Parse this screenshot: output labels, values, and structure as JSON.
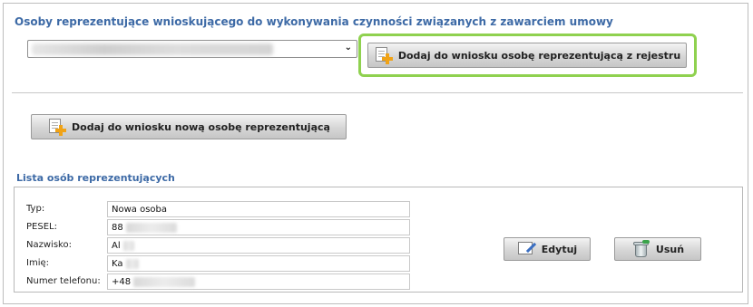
{
  "section": {
    "title": "Osoby reprezentujące wnioskującego do wykonywania czynności związanych z zawarciem umowy"
  },
  "select": {
    "selected_value": "—"
  },
  "buttons": {
    "add_from_registry": "Dodaj do wniosku osobę reprezentującą z rejestru",
    "add_new": "Dodaj do wniosku nową osobę reprezentującą",
    "edit": "Edytuj",
    "delete": "Usuń"
  },
  "list": {
    "title": "Lista osób reprezentujących",
    "fields": [
      {
        "label": "Typ:",
        "value": "Nowa osoba"
      },
      {
        "label": "PESEL:",
        "value": "88"
      },
      {
        "label": "Nazwisko:",
        "value": "Al"
      },
      {
        "label": "Imię:",
        "value": "Ka"
      },
      {
        "label": "Numer telefonu:",
        "value": "+48"
      }
    ]
  },
  "icons": {
    "add_document": "add-document-icon",
    "edit": "edit-icon",
    "delete": "trash-icon",
    "dropdown": "chevron-down-icon"
  },
  "colors": {
    "title": "#3d6aa6",
    "highlight": "#8fd14f",
    "plus": "#f0a317"
  }
}
